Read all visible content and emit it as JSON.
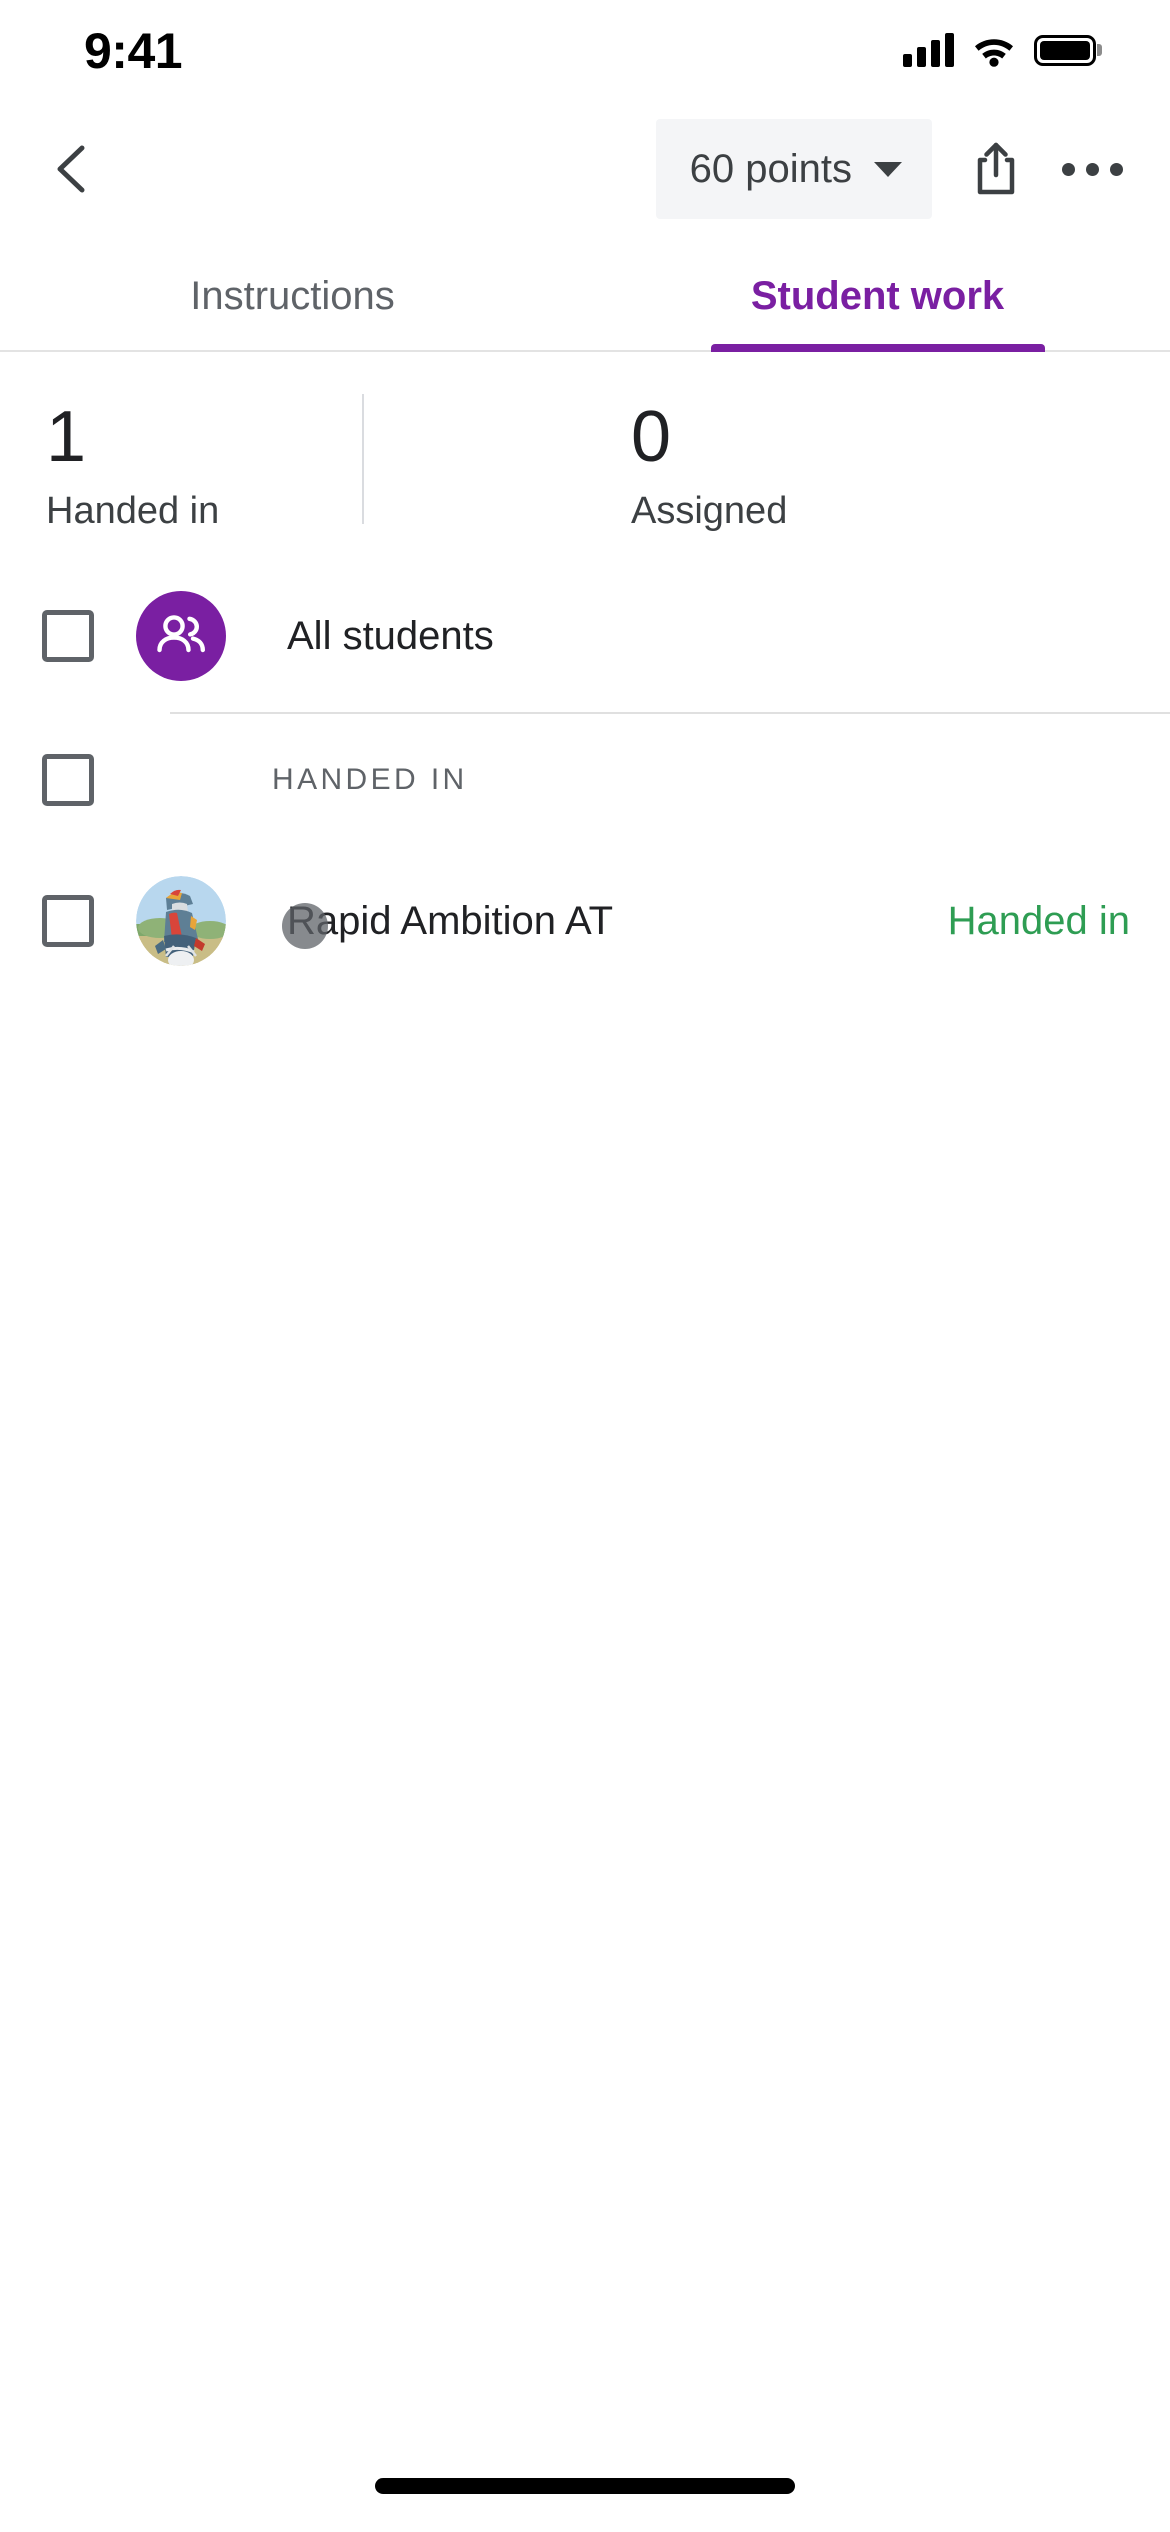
{
  "status_bar": {
    "time": "9:41",
    "cellular_icon": "signal-bars-icon",
    "wifi_icon": "wifi-icon",
    "battery_icon": "battery-full-icon"
  },
  "app_bar": {
    "back_icon": "back-chevron-icon",
    "points_value": "60 points",
    "points_caret_icon": "caret-down-icon",
    "share_icon": "share-icon",
    "more_icon": "more-options-icon"
  },
  "tabs": [
    {
      "label": "Instructions",
      "active": false
    },
    {
      "label": "Student work",
      "active": true
    }
  ],
  "stats": [
    {
      "value": "1",
      "label": "Handed in"
    },
    {
      "value": "0",
      "label": "Assigned"
    }
  ],
  "list": {
    "all_students": {
      "label": "All students",
      "avatar_icon": "people-group-icon",
      "checkbox_state": "unchecked"
    },
    "section_handed_in": {
      "title": "HANDED IN",
      "checkbox_state": "unchecked"
    },
    "students": [
      {
        "name": "Rapid Ambition AT",
        "status": "Handed in",
        "avatar_icon": "student-photo-avatar",
        "checkbox_state": "unchecked"
      }
    ]
  },
  "colors": {
    "accent_purple": "#7A1FA2",
    "status_green": "#2E9D53",
    "chip_background": "#f4f5f7",
    "text_primary": "#202124",
    "text_secondary": "#5f6368",
    "divider": "#e0e0e0"
  },
  "home_indicator": "home-indicator"
}
